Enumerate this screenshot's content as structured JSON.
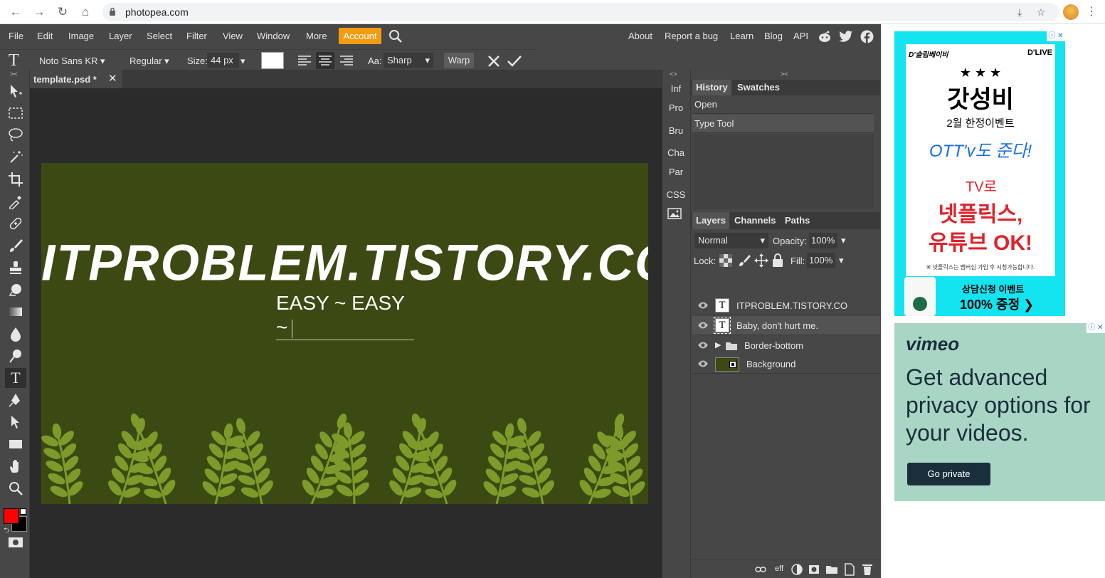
{
  "browser": {
    "url": "photopea.com"
  },
  "menu": {
    "items": [
      "File",
      "Edit",
      "Image",
      "Layer",
      "Select",
      "Filter",
      "View",
      "Window",
      "More"
    ],
    "account": "Account",
    "right_links": [
      "About",
      "Report a bug",
      "Learn",
      "Blog",
      "API"
    ]
  },
  "options": {
    "font": "Noto Sans KR",
    "style": "Regular",
    "size_label": "Size:",
    "size_value": "44 px",
    "aa_label": "Aa:",
    "aa_value": "Sharp",
    "warp": "Warp"
  },
  "document": {
    "tab_title": "template.psd *",
    "headline": "ITPROBLEM.TISTORY.COM",
    "subline": "EASY ~ EASY ~",
    "background_color": "#3b4a12",
    "leaf_color": "#7e9a2a"
  },
  "narrow_panel": [
    "Inf",
    "Pro",
    "Bru",
    "Cha",
    "Par",
    "CSS"
  ],
  "history": {
    "tabs": [
      "History",
      "Swatches"
    ],
    "items": [
      "Open",
      "Type Tool"
    ]
  },
  "layers": {
    "tabs": [
      "Layers",
      "Channels",
      "Paths"
    ],
    "blend_mode": "Normal",
    "opacity_label": "Opacity:",
    "opacity_value": "100%",
    "lock_label": "Lock:",
    "fill_label": "Fill:",
    "fill_value": "100%",
    "rows": [
      {
        "name": "ITPROBLEM.TISTORY.CO",
        "kind": "text"
      },
      {
        "name": "Baby, don't hurt me.",
        "kind": "text"
      },
      {
        "name": "Border-bottom",
        "kind": "folder"
      },
      {
        "name": "Background",
        "kind": "image"
      }
    ],
    "footer_eff": "eff"
  },
  "colors": {
    "foreground": "#ff0000",
    "background": "#000000",
    "accent": "#f39c12"
  },
  "ads": {
    "ad1": {
      "brand_left": "D'슬립베이비",
      "brand_right": "D'LIVE",
      "stars": "★ ★ ★",
      "headline": "갓성비",
      "subhead": "2월 한정이벤트",
      "ott": "OTT'v도 준다!",
      "tv": "TV로",
      "big1": "넷플릭스,",
      "big2": "유튜브 OK!",
      "fineprint": "※ 넷플릭스는 멤버십 가입 후 시청가능합니다.",
      "promo1": "상담신청 이벤트",
      "promo2": "100% 증정 ❯"
    },
    "ad2": {
      "brand": "vimeo",
      "text": "Get advanced privacy options for your videos.",
      "button": "Go private"
    }
  }
}
